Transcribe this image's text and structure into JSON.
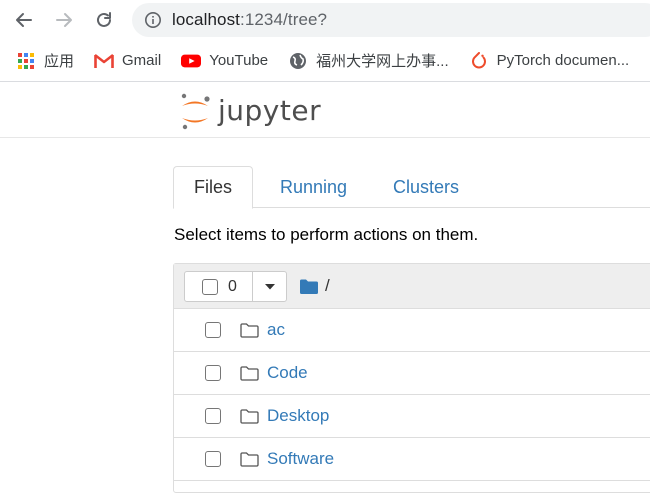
{
  "browser": {
    "url_host": "localhost",
    "url_rest": ":1234/tree?",
    "bookmarks": [
      {
        "label": "应用",
        "icon": "apps-grid-icon"
      },
      {
        "label": "Gmail",
        "icon": "gmail-icon"
      },
      {
        "label": "YouTube",
        "icon": "youtube-icon"
      },
      {
        "label": "福州大学网上办事...",
        "icon": "globe-icon"
      },
      {
        "label": "PyTorch documen...",
        "icon": "pytorch-icon"
      }
    ]
  },
  "jupyter": {
    "logo_text": "jupyter",
    "tabs": [
      {
        "label": "Files",
        "active": true
      },
      {
        "label": "Running",
        "active": false
      },
      {
        "label": "Clusters",
        "active": false
      }
    ],
    "instructions": "Select items to perform actions on them.",
    "selected_count": "0",
    "breadcrumb_sep": "/",
    "files": [
      {
        "name": "ac",
        "type": "folder"
      },
      {
        "name": "Code",
        "type": "folder"
      },
      {
        "name": "Desktop",
        "type": "folder"
      },
      {
        "name": "Software",
        "type": "folder"
      }
    ]
  },
  "colors": {
    "link": "#337ab7",
    "jupyter_orange": "#f37726"
  }
}
